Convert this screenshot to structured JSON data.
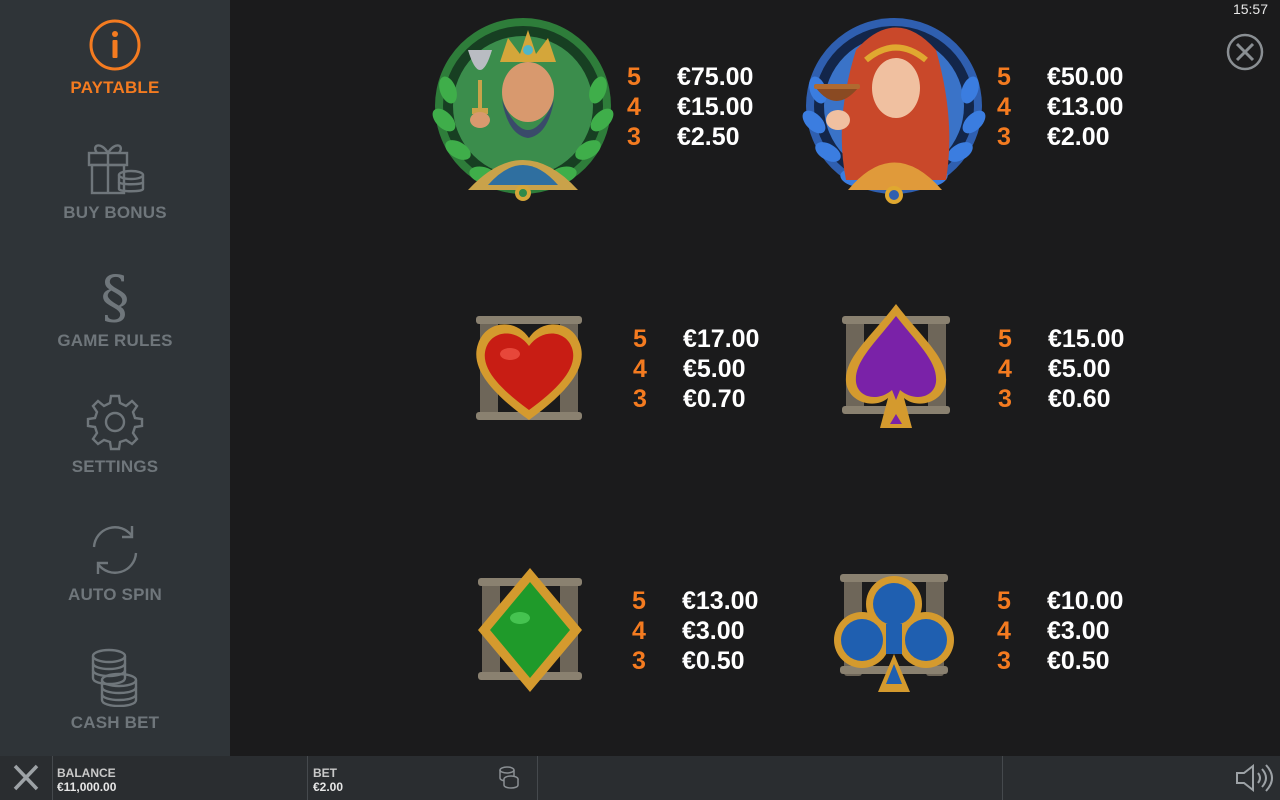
{
  "clock": "15:57",
  "sidebar": {
    "items": [
      {
        "label": "PAYTABLE",
        "icon": "info-icon",
        "active": true
      },
      {
        "label": "BUY BONUS",
        "icon": "gift-coins-icon"
      },
      {
        "label": "GAME RULES",
        "icon": "section-sign-icon"
      },
      {
        "label": "SETTINGS",
        "icon": "gear-icon"
      },
      {
        "label": "AUTO SPIN",
        "icon": "refresh-icon"
      },
      {
        "label": "CASH BET",
        "icon": "coin-stack-icon"
      }
    ]
  },
  "paytable": {
    "symbols": [
      {
        "name": "king",
        "pays": [
          {
            "count": "5",
            "value": "€75.00"
          },
          {
            "count": "4",
            "value": "€15.00"
          },
          {
            "count": "3",
            "value": "€2.50"
          }
        ]
      },
      {
        "name": "queen",
        "pays": [
          {
            "count": "5",
            "value": "€50.00"
          },
          {
            "count": "4",
            "value": "€13.00"
          },
          {
            "count": "3",
            "value": "€2.00"
          }
        ]
      },
      {
        "name": "heart",
        "pays": [
          {
            "count": "5",
            "value": "€17.00"
          },
          {
            "count": "4",
            "value": "€5.00"
          },
          {
            "count": "3",
            "value": "€0.70"
          }
        ]
      },
      {
        "name": "spade",
        "pays": [
          {
            "count": "5",
            "value": "€15.00"
          },
          {
            "count": "4",
            "value": "€5.00"
          },
          {
            "count": "3",
            "value": "€0.60"
          }
        ]
      },
      {
        "name": "diamond",
        "pays": [
          {
            "count": "5",
            "value": "€13.00"
          },
          {
            "count": "4",
            "value": "€3.00"
          },
          {
            "count": "3",
            "value": "€0.50"
          }
        ]
      },
      {
        "name": "club",
        "pays": [
          {
            "count": "5",
            "value": "€10.00"
          },
          {
            "count": "4",
            "value": "€3.00"
          },
          {
            "count": "3",
            "value": "€0.50"
          }
        ]
      }
    ]
  },
  "bottombar": {
    "balance_label": "BALANCE",
    "balance_value": "€11,000.00",
    "bet_label": "BET",
    "bet_value": "€2.00"
  },
  "colors": {
    "accent": "#f47b20",
    "sidebar_bg": "#2f3438",
    "muted_text": "#6f767b",
    "main_bg": "#1b1b1c"
  }
}
